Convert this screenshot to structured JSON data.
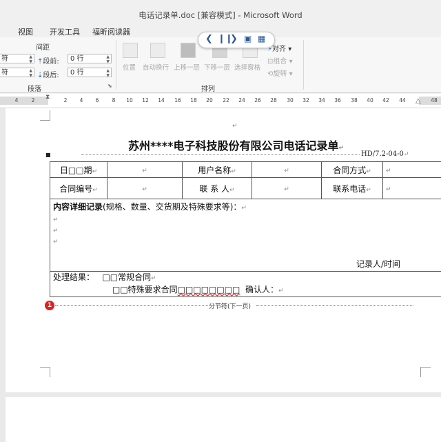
{
  "window": {
    "title": "电话记录单.doc [兼容模式] - Microsoft Word"
  },
  "ribbon_tabs": [
    "视图",
    "开发工具",
    "福昕阅读器"
  ],
  "paragraph_group": {
    "spacing_label": "间距",
    "before_label": "段前:",
    "before_value": "0 行",
    "after_label": "段后:",
    "after_value": "0 行",
    "left_value": "符",
    "right_value": "符",
    "group_label": "段落"
  },
  "arrange_group": {
    "buttons": [
      "位置",
      "自动换行",
      "上移一层",
      "下移一层",
      "选择窗格"
    ],
    "align": "对齐",
    "group": "组合",
    "rotate": "旋转",
    "group_label": "排列"
  },
  "ruler": {
    "ticks": [
      "4",
      "2",
      "2",
      "4",
      "6",
      "8",
      "10",
      "12",
      "14",
      "16",
      "18",
      "20",
      "22",
      "24",
      "26",
      "28",
      "30",
      "32",
      "34",
      "36",
      "38",
      "40",
      "42",
      "44",
      "48"
    ]
  },
  "document": {
    "title": "苏州****电子科技股份有限公司电话记录单",
    "doc_no": "HD/7.2-04-0",
    "row1": {
      "date_label": "日□□期",
      "user_label": "用户名称",
      "contract_method_label": "合同方式"
    },
    "row2": {
      "contract_no_label": "合同编号",
      "contact_label": "联 系 人",
      "phone_label": "联系电话"
    },
    "detail_bold": "内容详细记录",
    "detail_rest": "(规格、数量、交货期及特殊要求等)：",
    "recorder": "记录人/时间",
    "result_label": "处理结果：",
    "option1": "□□常规合同",
    "option2_prefix": "□□特殊要求合同",
    "option2_boxes": "□□□□□□□□",
    "confirm": "确认人：",
    "section_break": "分节符(下一页)",
    "para_mark": "↵",
    "badge": "1"
  },
  "colors": {
    "accent": "#2b5797",
    "badge": "#dd2222"
  }
}
